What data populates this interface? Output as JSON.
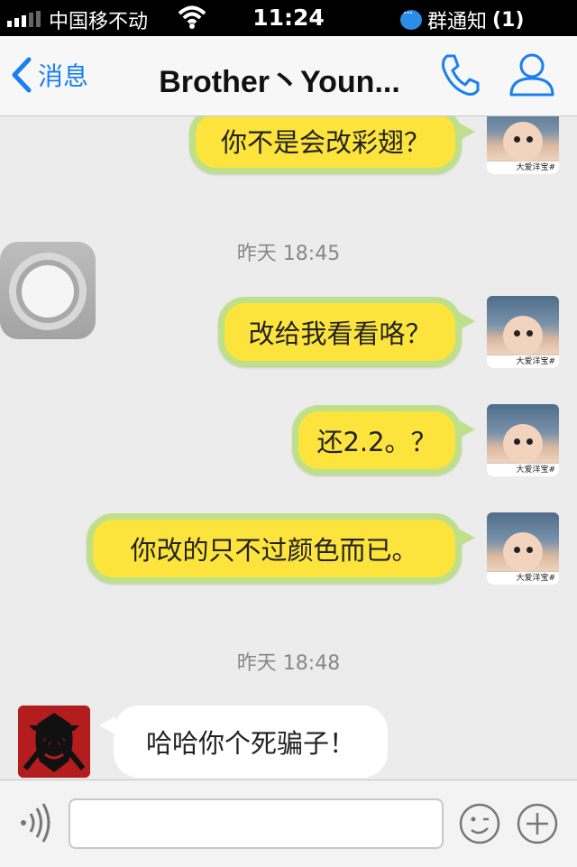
{
  "status_bar": {
    "carrier": "中国移不动",
    "time": "11:24",
    "notification_label": "群通知",
    "notification_count": "(1)"
  },
  "nav": {
    "back_label": "消息",
    "title": "Brother丶Youn..."
  },
  "chat": {
    "timestamps": [
      "昨天 18:45",
      "昨天 18:48"
    ],
    "messages": [
      {
        "direction": "out",
        "text": "你不是会改彩翅？"
      },
      {
        "direction": "out",
        "text": "改给我看看咯？"
      },
      {
        "direction": "out",
        "text": "还2.2。？"
      },
      {
        "direction": "out",
        "text": "你改的只不过颜色而已。"
      },
      {
        "direction": "in",
        "text": "哈哈你个死骗子！"
      }
    ],
    "avatar_caption": "大爱洋宝#"
  },
  "input": {
    "value": ""
  },
  "colors": {
    "bubble_out_fill": "#fde43c",
    "bubble_out_border": "#bfe08a",
    "accent": "#1a7ff0"
  },
  "icons": [
    "voice-icon",
    "emoji-icon",
    "plus-icon",
    "phone-icon",
    "contact-icon",
    "back-chevron-icon",
    "wifi-icon"
  ]
}
